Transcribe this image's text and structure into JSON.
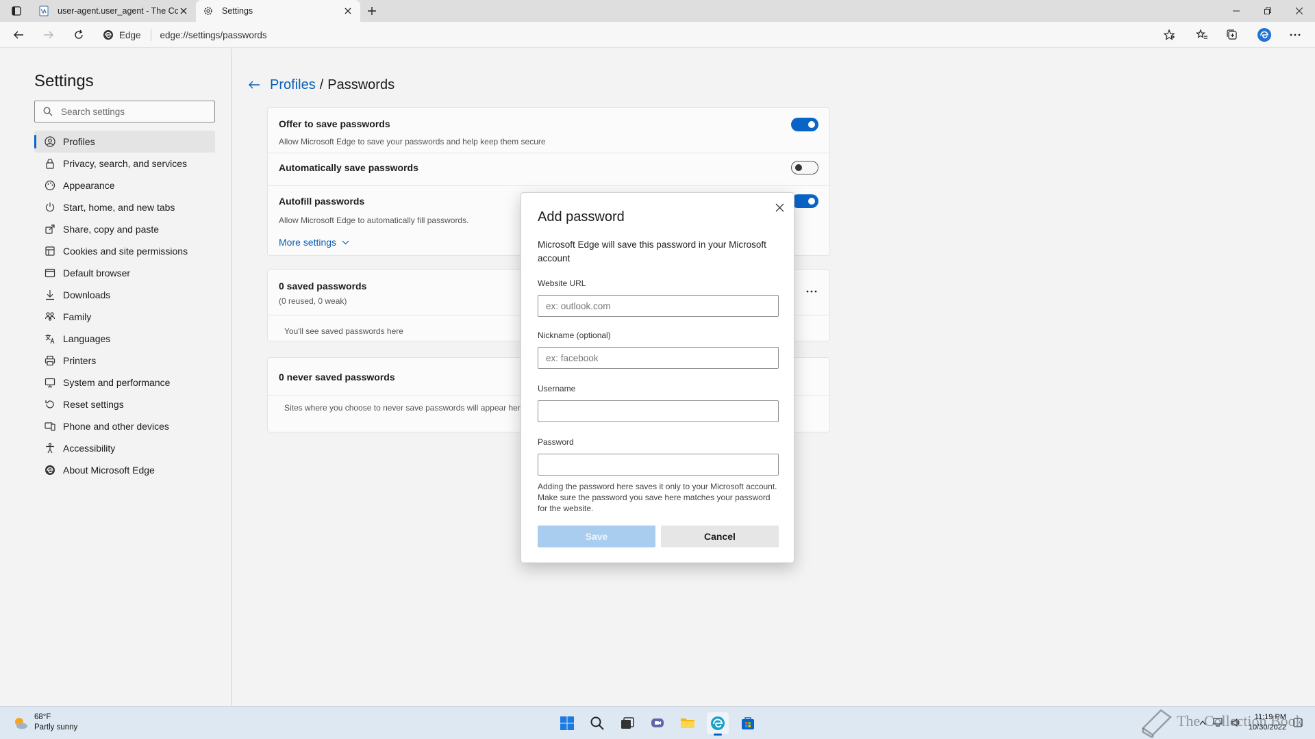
{
  "tabs": [
    {
      "title": "user-agent.user_agent - The Coll",
      "icon": "document-icon"
    },
    {
      "title": "Settings",
      "icon": "gear-icon"
    }
  ],
  "address": {
    "badge": "Edge",
    "url": "edge://settings/passwords"
  },
  "sidebar": {
    "title": "Settings",
    "search_placeholder": "Search settings",
    "items": [
      {
        "label": "Profiles",
        "icon": "profile-icon"
      },
      {
        "label": "Privacy, search, and services",
        "icon": "lock-icon"
      },
      {
        "label": "Appearance",
        "icon": "appearance-icon"
      },
      {
        "label": "Start, home, and new tabs",
        "icon": "power-icon"
      },
      {
        "label": "Share, copy and paste",
        "icon": "share-icon"
      },
      {
        "label": "Cookies and site permissions",
        "icon": "cookie-icon"
      },
      {
        "label": "Default browser",
        "icon": "browser-icon"
      },
      {
        "label": "Downloads",
        "icon": "download-icon"
      },
      {
        "label": "Family",
        "icon": "family-icon"
      },
      {
        "label": "Languages",
        "icon": "language-icon"
      },
      {
        "label": "Printers",
        "icon": "printer-icon"
      },
      {
        "label": "System and performance",
        "icon": "system-icon"
      },
      {
        "label": "Reset settings",
        "icon": "reset-icon"
      },
      {
        "label": "Phone and other devices",
        "icon": "phone-icon"
      },
      {
        "label": "Accessibility",
        "icon": "accessibility-icon"
      },
      {
        "label": "About Microsoft Edge",
        "icon": "edge-icon"
      }
    ]
  },
  "main": {
    "breadcrumb_parent": "Profiles",
    "breadcrumb_sep": "/",
    "breadcrumb_current": "Passwords",
    "offer_title": "Offer to save passwords",
    "offer_sub": "Allow Microsoft Edge to save your passwords and help keep them secure",
    "offer_on": true,
    "auto_title": "Automatically save passwords",
    "auto_on": false,
    "autofill_title": "Autofill passwords",
    "autofill_sub": "Allow Microsoft Edge to automatically fill passwords.",
    "autofill_on": true,
    "more_settings": "More settings",
    "saved_title": "0 saved passwords",
    "saved_sub": "(0 reused, 0 weak)",
    "saved_empty": "You'll see saved passwords here",
    "never_title": "0 never saved passwords",
    "never_empty": "Sites where you choose to never save passwords will appear here"
  },
  "dialog": {
    "title": "Add password",
    "description": "Microsoft Edge will save this password in your Microsoft account",
    "url_label": "Website URL",
    "url_placeholder": "ex: outlook.com",
    "nickname_label": "Nickname (optional)",
    "nickname_placeholder": "ex: facebook",
    "username_label": "Username",
    "username_value": "",
    "password_label": "Password",
    "password_value": "",
    "note": "Adding the password here saves it only to your Microsoft account. Make sure the password you save here matches your password for the website.",
    "save_label": "Save",
    "cancel_label": "Cancel"
  },
  "taskbar": {
    "weather_temp": "68°F",
    "weather_desc": "Partly sunny",
    "time": "11:19 PM",
    "date": "10/30/2022",
    "watermark": "The Collection Book"
  },
  "colors": {
    "accent": "#0a64c8",
    "link": "#0a5fb4"
  }
}
